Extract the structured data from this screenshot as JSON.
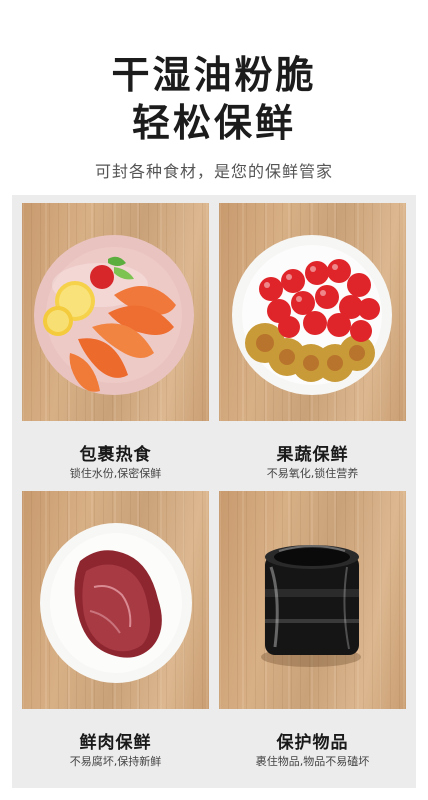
{
  "header": {
    "title_line1": "干湿油粉脆",
    "title_line2": "轻松保鲜",
    "subtitle": "可封各种食材，是您的保鲜管家"
  },
  "cards": [
    {
      "title": "包裹热食",
      "desc": "锁住水份,保密保鲜",
      "image": "plate-of-shrimp-and-lemon"
    },
    {
      "title": "果蔬保鲜",
      "desc": "不易氧化,锁住营养",
      "image": "plate-of-tomatoes-and-kiwi"
    },
    {
      "title": "鲜肉保鲜",
      "desc": "不易腐坏,保持新鲜",
      "image": "plate-of-raw-beef"
    },
    {
      "title": "保护物品",
      "desc": "裹住物品,物品不易磕坏",
      "image": "wrapped-camera-lens"
    }
  ]
}
